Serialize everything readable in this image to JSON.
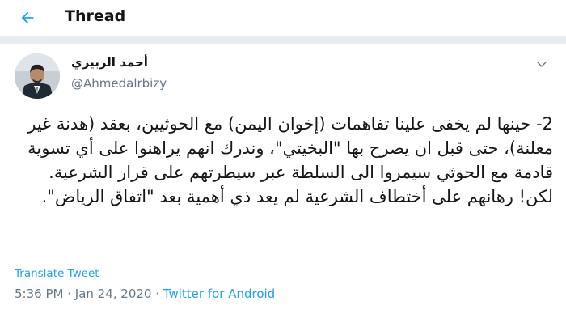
{
  "header": {
    "title": "Thread",
    "back_icon": "arrow-left-icon"
  },
  "tweet": {
    "author_name": "أحمد الربيزي",
    "author_handle": "@Ahmedalrbizy",
    "text_lines": [
      "2- حينها لم يخفى علينا تفاهمات (إخوان اليمن) مع الحوثيين، بعقد (هدنة غير معلنة)، حتى قبل ان يصرح بها \"البخيتي\"، وندرك انهم يراهنوا على أي تسوية قادمة مع الحوثي سيمروا الى السلطة عبر سيطرتهم على قرار الشرعية.",
      "لكن! رهانهم على أختطاف الشرعية لم يعد ذي أهمية بعد \"اتفاق الرياض\"."
    ],
    "translate_label": "Translate Tweet",
    "time": "5:36 PM",
    "separator": " · ",
    "date": "Jan 24, 2020",
    "source": "Twitter for Android"
  },
  "colors": {
    "accent": "#1da1f2",
    "secondary_text": "#657786",
    "divider": "#e6ecf0"
  }
}
